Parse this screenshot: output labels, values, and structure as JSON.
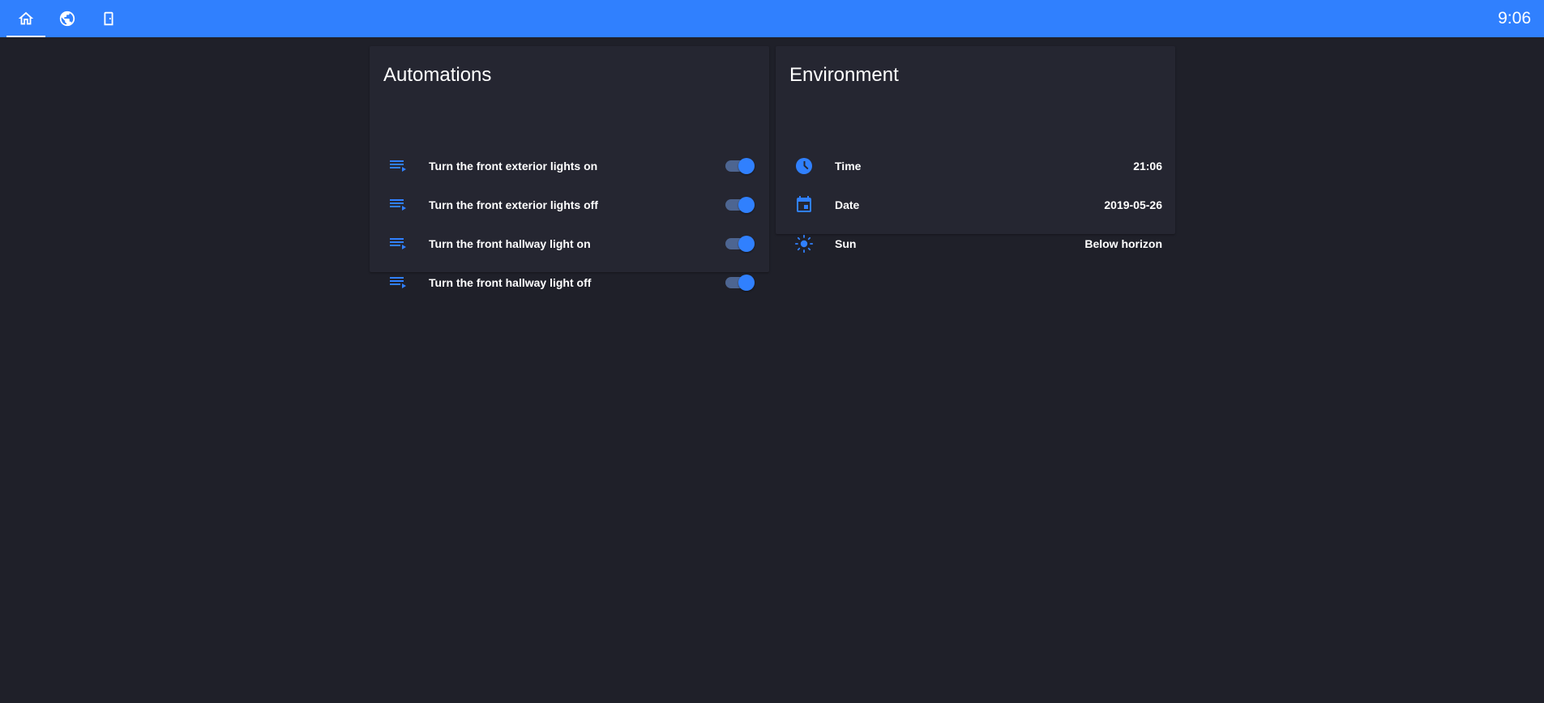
{
  "colors": {
    "background": "#1f2029",
    "topbar": "#3080fe",
    "card": "#252631",
    "accent": "#3080fe",
    "toggle_track": "#4d6591"
  },
  "topbar": {
    "tabs": [
      {
        "icon": "home-icon",
        "active": true
      },
      {
        "icon": "globe-icon",
        "active": false
      },
      {
        "icon": "door-icon",
        "active": false
      }
    ],
    "clock": "9:06"
  },
  "automations": {
    "title": "Automations",
    "items": [
      {
        "icon": "playlist-play-icon",
        "label": "Turn the front exterior lights on",
        "enabled": true
      },
      {
        "icon": "playlist-play-icon",
        "label": "Turn the front exterior lights off",
        "enabled": true
      },
      {
        "icon": "playlist-play-icon",
        "label": "Turn the front hallway light on",
        "enabled": true
      },
      {
        "icon": "playlist-play-icon",
        "label": "Turn the front hallway light off",
        "enabled": true
      }
    ]
  },
  "environment": {
    "title": "Environment",
    "items": [
      {
        "icon": "clock-icon",
        "label": "Time",
        "value": "21:06"
      },
      {
        "icon": "calendar-icon",
        "label": "Date",
        "value": "2019-05-26"
      },
      {
        "icon": "sun-icon",
        "label": "Sun",
        "value": "Below horizon"
      }
    ]
  }
}
